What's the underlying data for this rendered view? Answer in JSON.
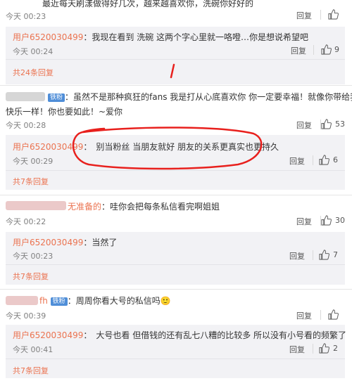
{
  "labels": {
    "reply": "回复",
    "today": "今天"
  },
  "comments": [
    {
      "text": "最近每天刷漾做得好几次，越来越喜欢你，洗碗你好好的",
      "time": "今天 00:23",
      "replies": [
        {
          "user": "用户6520030499",
          "text": "我现在看到 洗碗 这两个字心里就一咯噔…你是想说希望吧",
          "time": "今天 00:24",
          "likes": "9"
        }
      ],
      "more": "共24条回复"
    },
    {
      "badge": "铁粉",
      "text_line1": "虽然不是那种疯狂的fans 我是打从心底喜欢你 你一定要幸福！就像你带给我们",
      "text_line2": "快乐一样！你也要如此！~爱你",
      "time": "今天 00:28",
      "likes": "53",
      "replies": [
        {
          "user": "用户6520030499",
          "text": "别当粉丝 当朋友就好 朋友的关系更真实也更持久",
          "time": "今天 00:29",
          "likes": "6"
        }
      ],
      "more": "共7条回复"
    },
    {
      "user_suffix": "无准备的",
      "text": "哇你会把每条私信看完啊姐姐",
      "time": "今天 00:22",
      "likes": "30",
      "replies": [
        {
          "user": "用户6520030499",
          "text": "当然了",
          "time": "今天 00:23",
          "likes": "7"
        }
      ],
      "more": "共7条回复"
    },
    {
      "user_suffix": "fh",
      "badge": "铁粉",
      "text": "周周你看大号的私信吗",
      "emoji": "🙂",
      "time": "今天 00:39",
      "likes": "",
      "replies": [
        {
          "user": "用户6520030499",
          "text": "大号也看 但借钱的还有乱七八糟的比较多 所以没有小号看的频繁了",
          "time": "今天 00:41",
          "likes": "2"
        }
      ],
      "more": "共7条回复"
    }
  ],
  "colors": {
    "username": "#eb7350",
    "annotation_red": "#e8201d",
    "reply_bg": "#f2f2f5",
    "badge": "#4f8ed8"
  }
}
